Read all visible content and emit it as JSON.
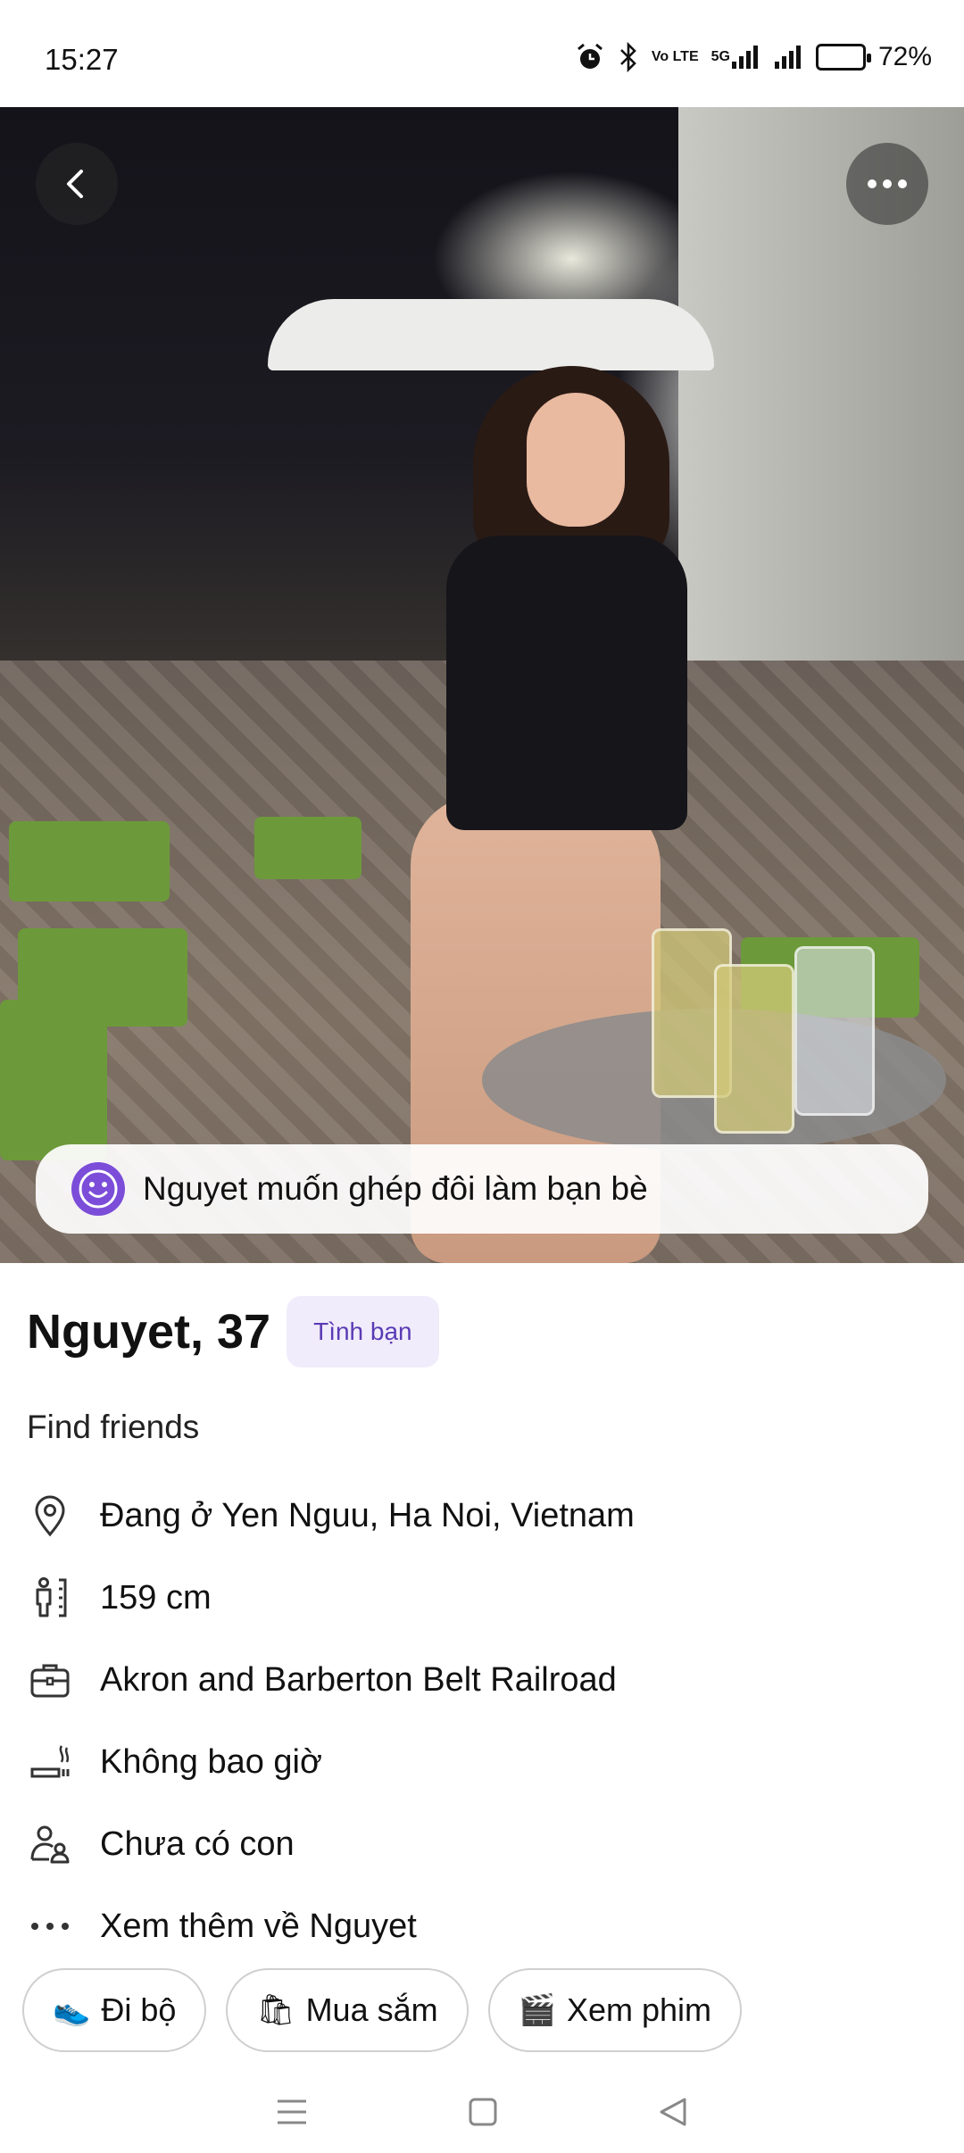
{
  "status_bar": {
    "time": "15:27",
    "network_label": "Vo LTE",
    "signal_label": "5G",
    "battery_percent": "72%",
    "battery_level": 0.72
  },
  "profile": {
    "name_age": "Nguyet, 37",
    "badge": "Tình bạn",
    "match_message": "Nguyet muốn ghép đôi làm bạn bè",
    "subtitle": "Find friends",
    "info": [
      {
        "icon": "location-pin-icon",
        "text": "Đang ở Yen Nguu, Ha Noi, Vietnam"
      },
      {
        "icon": "height-icon",
        "text": "159 cm"
      },
      {
        "icon": "briefcase-icon",
        "text": "Akron and Barberton Belt Railroad"
      },
      {
        "icon": "smoking-icon",
        "text": "Không bao giờ"
      },
      {
        "icon": "children-icon",
        "text": "Chưa có con"
      },
      {
        "icon": "more-dots-icon",
        "text": "Xem thêm về Nguyet"
      }
    ],
    "interests": [
      {
        "emoji": "👟",
        "label": "Đi bộ"
      },
      {
        "emoji": "🛍",
        "label": "Mua sắm"
      },
      {
        "emoji": "🎬",
        "label": "Xem phim"
      }
    ]
  },
  "colors": {
    "accent": "#7b4dd8",
    "badge_bg": "#f1ecfb",
    "badge_text": "#5a3bb5"
  }
}
